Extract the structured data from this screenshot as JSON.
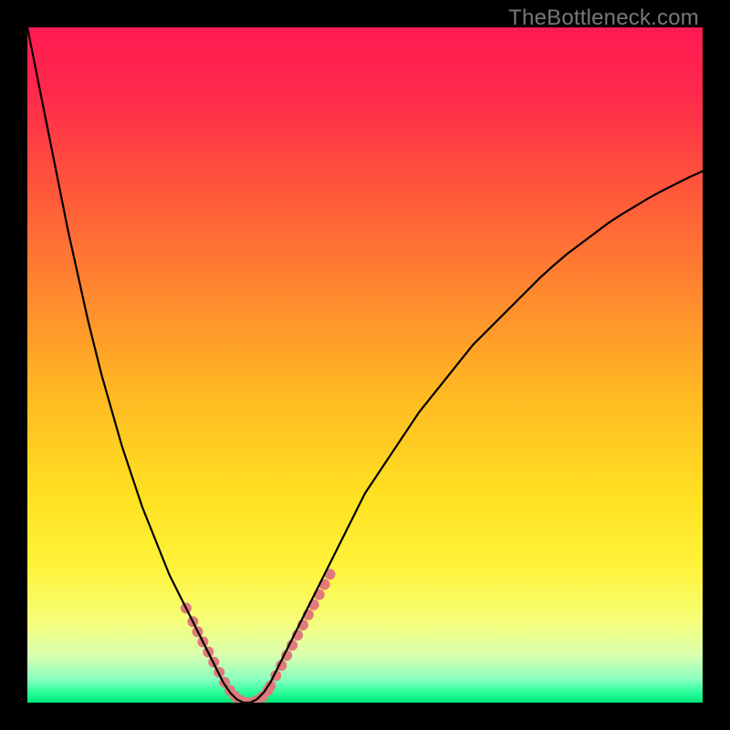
{
  "watermark": "TheBottleneck.com",
  "gradient": {
    "stops": [
      {
        "offset": 0.0,
        "color": "#ff1a53"
      },
      {
        "offset": 0.1,
        "color": "#ff2a4b"
      },
      {
        "offset": 0.25,
        "color": "#ff5a3a"
      },
      {
        "offset": 0.4,
        "color": "#ff8a2e"
      },
      {
        "offset": 0.55,
        "color": "#ffbb22"
      },
      {
        "offset": 0.7,
        "color": "#ffe222"
      },
      {
        "offset": 0.8,
        "color": "#fff33a"
      },
      {
        "offset": 0.88,
        "color": "#f6ff7a"
      },
      {
        "offset": 0.93,
        "color": "#d9ffb0"
      },
      {
        "offset": 0.965,
        "color": "#8affc0"
      },
      {
        "offset": 0.985,
        "color": "#2aff9a"
      },
      {
        "offset": 1.0,
        "color": "#00e57a"
      }
    ]
  },
  "chart_data": {
    "type": "line",
    "title": "",
    "xlabel": "",
    "ylabel": "",
    "xlim": [
      0,
      100
    ],
    "ylim": [
      0,
      100
    ],
    "x": [
      0,
      1,
      2,
      3,
      4,
      5,
      6,
      7,
      8,
      9,
      10,
      11,
      12,
      13,
      14,
      15,
      16,
      17,
      18,
      19,
      20,
      21,
      22,
      23,
      24,
      25,
      26,
      27,
      28,
      29,
      30,
      31,
      32,
      33,
      34,
      35,
      36,
      37,
      38,
      39,
      40,
      41,
      42,
      43,
      44,
      45,
      46,
      47,
      48,
      49,
      50,
      52,
      54,
      56,
      58,
      60,
      62,
      64,
      66,
      68,
      70,
      72,
      74,
      76,
      78,
      80,
      82,
      84,
      86,
      88,
      90,
      92,
      94,
      96,
      98,
      100
    ],
    "values": [
      100.0,
      95.0,
      90.0,
      85.0,
      80.0,
      75.0,
      70.0,
      65.5,
      61.0,
      56.5,
      52.5,
      48.5,
      45.0,
      41.5,
      38.0,
      35.0,
      32.0,
      29.0,
      26.5,
      24.0,
      21.5,
      19.0,
      17.0,
      15.0,
      13.0,
      11.0,
      9.0,
      7.0,
      5.0,
      3.0,
      1.5,
      0.5,
      0.0,
      0.0,
      0.5,
      1.5,
      3.0,
      5.0,
      7.0,
      9.0,
      11.0,
      13.0,
      15.0,
      17.0,
      19.0,
      21.0,
      23.0,
      25.0,
      27.0,
      29.0,
      31.0,
      34.0,
      37.0,
      40.0,
      43.0,
      45.5,
      48.0,
      50.5,
      53.0,
      55.0,
      57.0,
      59.0,
      61.0,
      63.0,
      64.8,
      66.5,
      68.0,
      69.5,
      71.0,
      72.3,
      73.5,
      74.7,
      75.8,
      76.8,
      77.8,
      78.7
    ],
    "markers": {
      "color": "#e07a7a",
      "radius_px": 6,
      "x": [
        23.5,
        24.5,
        25.2,
        26.0,
        26.8,
        27.6,
        28.4,
        29.2,
        30.0,
        30.8,
        31.6,
        32.4,
        33.2,
        34.0,
        34.8,
        35.6,
        36.0,
        36.8,
        37.6,
        38.4,
        39.2,
        40.0,
        40.8,
        41.6,
        42.4,
        43.2,
        44.0,
        44.8
      ],
      "values": [
        14.0,
        12.0,
        10.5,
        9.0,
        7.5,
        6.0,
        4.5,
        3.0,
        1.8,
        0.9,
        0.3,
        0.0,
        0.0,
        0.3,
        0.9,
        1.8,
        2.5,
        4.0,
        5.5,
        7.0,
        8.5,
        10.0,
        11.5,
        13.0,
        14.5,
        16.0,
        17.5,
        19.0
      ]
    }
  }
}
